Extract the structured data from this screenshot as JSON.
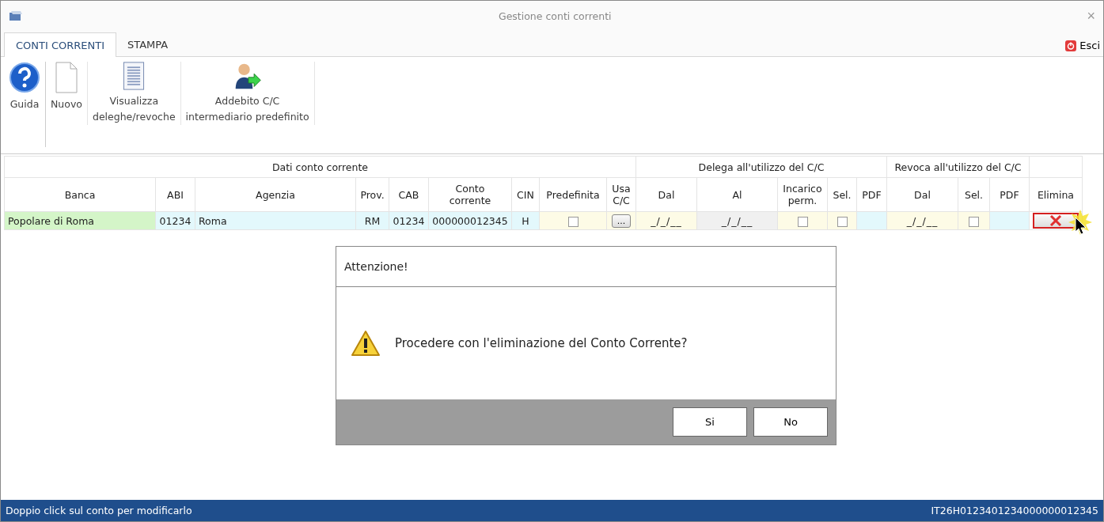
{
  "window": {
    "title": "Gestione conti correnti",
    "close": "×"
  },
  "tabs": [
    {
      "label": "CONTI CORRENTI",
      "selected": true
    },
    {
      "label": "STAMPA",
      "selected": false
    }
  ],
  "exit_button": {
    "label": "Esci"
  },
  "ribbon": [
    {
      "label": "Guida"
    },
    {
      "label": "Nuovo"
    },
    {
      "label": "Visualizza\ndeleghe/revoche"
    },
    {
      "label": "Addebito C/C\nintermediario predefinito"
    }
  ],
  "table": {
    "groups": [
      "Dati conto corrente",
      "Delega all'utilizzo del C/C",
      "Revoca all'utilizzo del C/C"
    ],
    "columns": [
      "Banca",
      "ABI",
      "Agenzia",
      "Prov.",
      "CAB",
      "Conto\ncorrente",
      "CIN",
      "Predefinita",
      "Usa\nC/C",
      "Dal",
      "Al",
      "Incarico\nperm.",
      "Sel.",
      "PDF",
      "Dal",
      "Sel.",
      "PDF",
      "Elimina"
    ],
    "rows": [
      {
        "cells": [
          {
            "kind": "text",
            "text": "Popolare di Roma",
            "color": "#d4f5c8"
          },
          {
            "kind": "text",
            "text": "01234",
            "color": "#e3f8fc"
          },
          {
            "kind": "text",
            "text": "Roma",
            "color": "#e3f8fc"
          },
          {
            "kind": "text",
            "text": "RM",
            "color": "#e3f8fc"
          },
          {
            "kind": "text",
            "text": "01234",
            "color": "#e3f8fc"
          },
          {
            "kind": "text",
            "text": "000000012345",
            "color": "#e3f8fc"
          },
          {
            "kind": "text",
            "text": "H",
            "color": "#e3f8fc"
          },
          {
            "kind": "checkbox",
            "checked": false,
            "color": "#fdfbe6"
          },
          {
            "kind": "button",
            "text": "...",
            "color": "#fdfbe6"
          },
          {
            "kind": "date",
            "text": "_/_/__",
            "color": "#fdfbe6"
          },
          {
            "kind": "date",
            "text": "_/_/__",
            "color": "#f0f0f0"
          },
          {
            "kind": "checkbox",
            "checked": false,
            "color": "#fdfbe6"
          },
          {
            "kind": "checkbox",
            "checked": false,
            "color": "#fdfbe6"
          },
          {
            "kind": "empty",
            "color": "#e3f8fc"
          },
          {
            "kind": "date",
            "text": "_/_/__",
            "color": "#fdfbe6"
          },
          {
            "kind": "checkbox",
            "checked": false,
            "color": "#fdfbe6"
          },
          {
            "kind": "empty",
            "color": "#e3f8fc"
          },
          {
            "kind": "delete",
            "color": "#ffffff"
          }
        ]
      }
    ]
  },
  "dialog": {
    "title": "Attenzione!",
    "message": "Procedere con l'eliminazione del Conto Corrente?",
    "buttons": [
      "Si",
      "No"
    ]
  },
  "status_bar": {
    "hint": "Doppio click sul conto per modificarlo",
    "iban": "IT26H0123401234000000012345"
  }
}
